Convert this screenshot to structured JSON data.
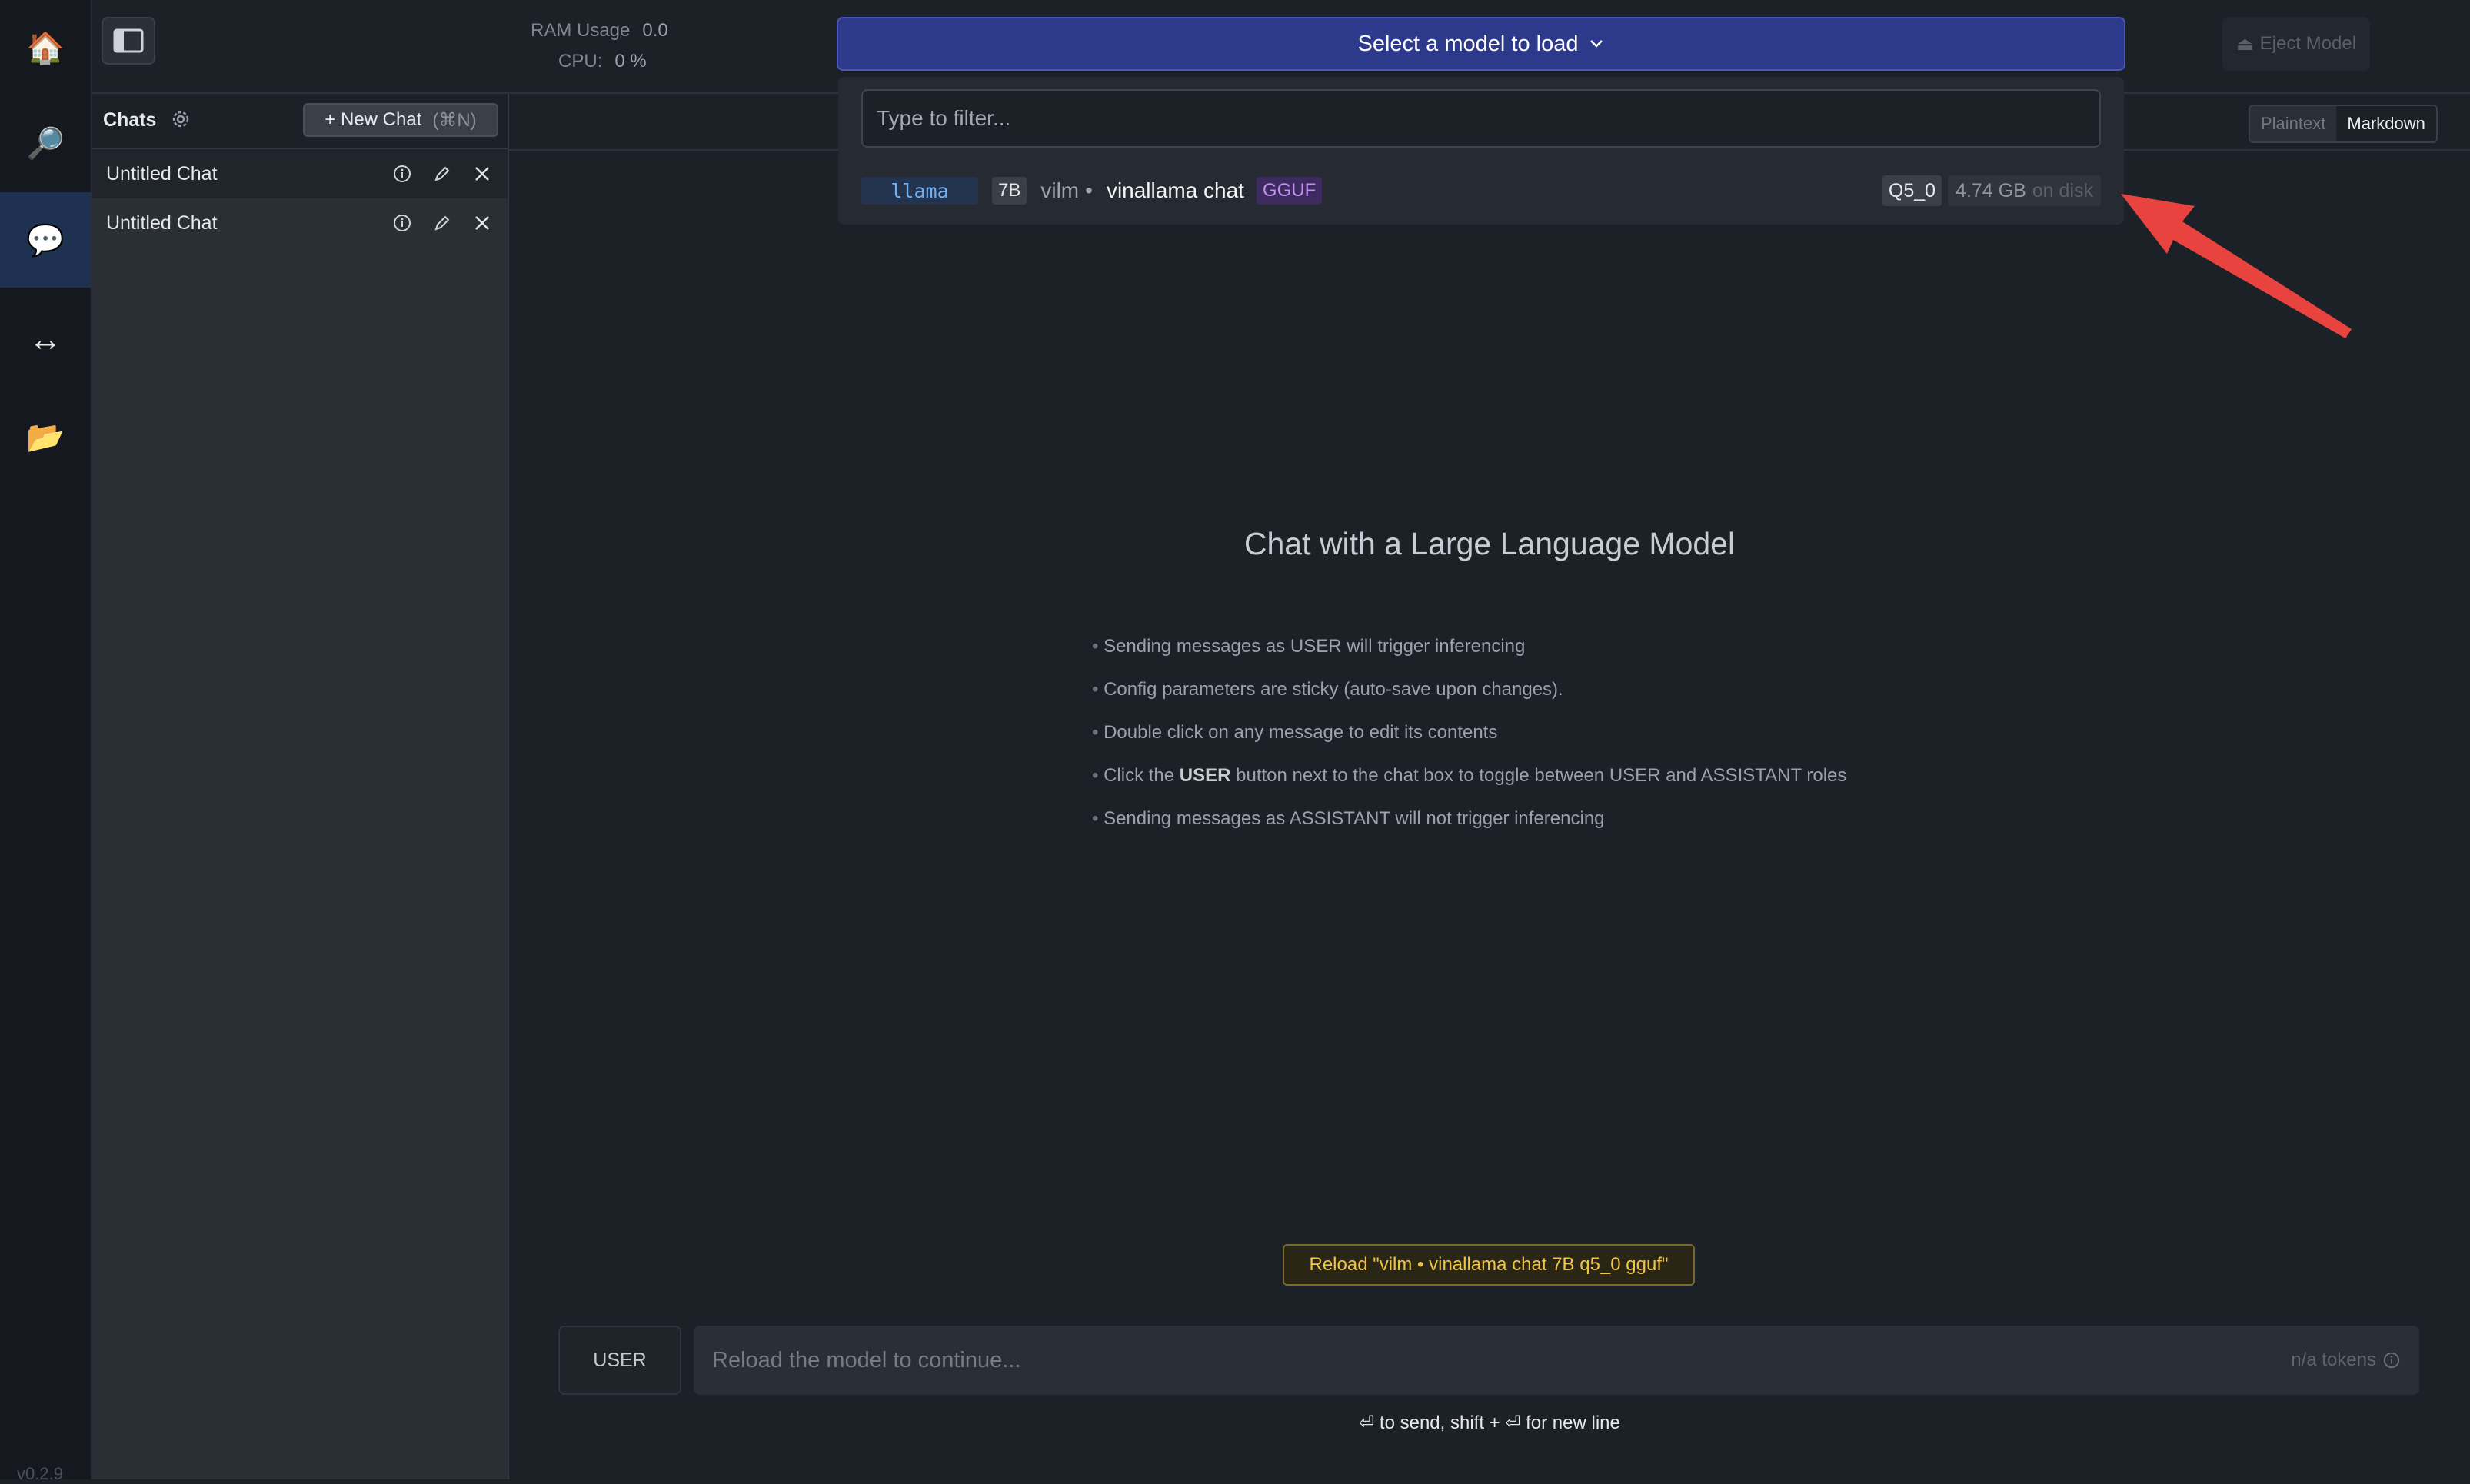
{
  "rail": {
    "items": [
      {
        "name": "home",
        "icon": "house-icon",
        "glyph": "🏠"
      },
      {
        "name": "search",
        "icon": "magnifier-icon",
        "glyph": "🔎"
      },
      {
        "name": "chat",
        "icon": "speech-bubble-icon",
        "glyph": "💬"
      },
      {
        "name": "server",
        "icon": "left-right-arrow-icon",
        "glyph": "↔"
      },
      {
        "name": "my-models",
        "icon": "folder-icon",
        "glyph": "📂"
      }
    ],
    "version": "v0.2.9"
  },
  "topbar": {
    "ram_label": "RAM Usage",
    "ram_value": "0.0",
    "cpu_label": "CPU:",
    "cpu_value": "0 %",
    "model_select_label": "Select a model to load",
    "eject_label": "Eject Model",
    "eject_icon": "eject-icon"
  },
  "chats": {
    "title": "Chats",
    "new_chat_label": "+ New Chat",
    "new_chat_shortcut": "(⌘N)",
    "items": [
      {
        "title": "Untitled Chat"
      },
      {
        "title": "Untitled Chat"
      }
    ]
  },
  "format_toggle": {
    "plaintext": "Plaintext",
    "markdown": "Markdown",
    "selected": "Markdown"
  },
  "dropdown": {
    "filter_placeholder": "Type to filter...",
    "models": [
      {
        "arch": "llama",
        "size": "7B",
        "author": "vilm",
        "separator": "•",
        "name": "vinallama chat",
        "format": "GGUF",
        "quant": "Q5_0",
        "disk_size": "4.74 GB",
        "disk_suffix": "on disk"
      }
    ]
  },
  "main": {
    "title": "Chat with a Large Language Model",
    "tips": {
      "t1": "Sending messages as USER will trigger inferencing",
      "t2": "Config parameters are sticky (auto-save upon changes).",
      "t3": "Double click on any message to edit its contents",
      "t4_pre": "Click the ",
      "t4_strong": "USER",
      "t4_post": " button next to the chat box to toggle between USER and ASSISTANT roles",
      "t5": "Sending messages as ASSISTANT will not trigger inferencing"
    },
    "reload_label": "Reload \"vilm • vinallama chat 7B q5_0 gguf\"",
    "role_label": "USER",
    "input_placeholder": "Reload the model to continue...",
    "tokens_label": "n/a tokens",
    "hint": "⏎ to send, shift + ⏎ for new line"
  },
  "colors": {
    "accent": "#2d3a8c",
    "annotation_arrow": "#e8433f",
    "reload_text": "#f2c443"
  }
}
